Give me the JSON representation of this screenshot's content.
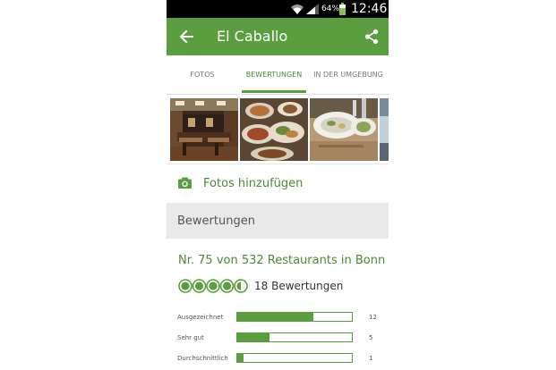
{
  "status_bar": {
    "battery_percent": "64%",
    "time": "12:46",
    "icons": [
      "wifi-icon",
      "signal-icon",
      "battery-icon"
    ]
  },
  "app_bar": {
    "title": "El Caballo",
    "back_icon": "arrow-left-icon",
    "share_icon": "share-icon",
    "color": "#5a9e3f"
  },
  "tabs": [
    {
      "label": "FOTOS",
      "active": false
    },
    {
      "label": "BEWERTUNGEN",
      "active": true
    },
    {
      "label": "IN DER UMGEBUNG",
      "active": false
    }
  ],
  "photos": [
    "restaurant-interior-photo",
    "food-platter-photo",
    "seafood-dish-photo",
    "partial-photo"
  ],
  "add_photos": {
    "label": "Fotos hinzufügen",
    "icon": "camera-icon"
  },
  "reviews_section": {
    "header": "Bewertungen",
    "ranking": "Nr. 75 von 532 Restaurants in Bonn",
    "rating_bubbles": 4.5,
    "review_count": "18 Bewertungen",
    "distribution": [
      {
        "label": "Ausgezeichnet",
        "count": "12",
        "fraction": 0.667
      },
      {
        "label": "Sehr gut",
        "count": "5",
        "fraction": 0.278
      },
      {
        "label": "Durchschnittlich",
        "count": "1",
        "fraction": 0.056
      }
    ]
  },
  "colors": {
    "brand_green": "#5a9e3f",
    "text_green": "#4a8a33",
    "header_gray": "#e9e9e9"
  }
}
